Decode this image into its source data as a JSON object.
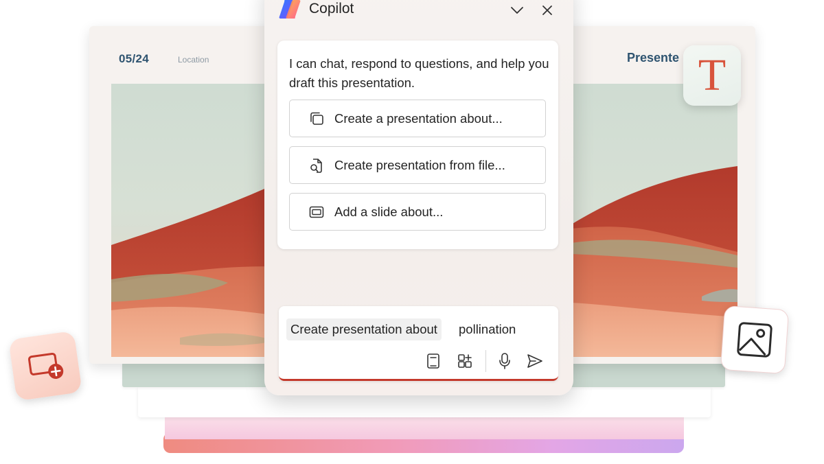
{
  "slide": {
    "date": "05/24",
    "location": "Location",
    "title": "Presente"
  },
  "copilot": {
    "title": "Copilot",
    "logo_icon": "copilot-logo-icon",
    "collapse_icon": "chevron-down-icon",
    "close_icon": "close-icon",
    "message": "I can chat, respond to questions, and help you draft this presentation.",
    "suggestions": [
      {
        "label": "Create a presentation about...",
        "icon": "copy-pages-icon"
      },
      {
        "label": "Create presentation from file...",
        "icon": "document-search-icon"
      },
      {
        "label": "Add a slide about...",
        "icon": "slide-layout-icon"
      }
    ],
    "composer": {
      "prompt_chip": "Create presentation about",
      "prompt_text": "pollination",
      "tools": [
        "notebook-icon",
        "add-apps-icon",
        "microphone-icon",
        "send-icon"
      ]
    }
  },
  "badges": {
    "text_badge_glyph": "T",
    "image_badge_icon": "image-icon",
    "add_badge_icon": "add-slide-icon"
  },
  "colors": {
    "accent_red": "#c4392b",
    "slide_text": "#2f5470",
    "text_badge": "#d8543c"
  }
}
